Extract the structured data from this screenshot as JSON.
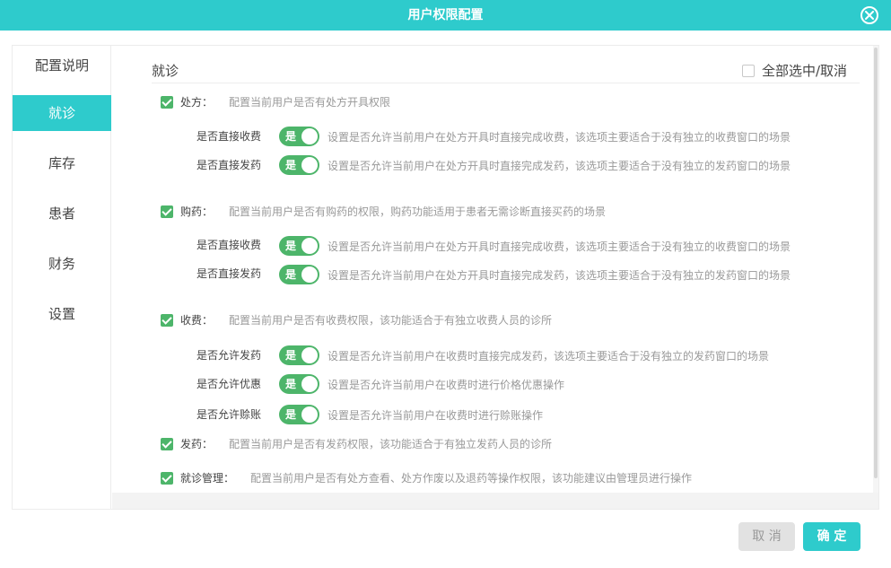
{
  "window": {
    "title": "用户权限配置"
  },
  "sidebar": {
    "title": "配置说明",
    "items": [
      {
        "label": "就诊",
        "active": true
      },
      {
        "label": "库存",
        "active": false
      },
      {
        "label": "患者",
        "active": false
      },
      {
        "label": "财务",
        "active": false
      },
      {
        "label": "设置",
        "active": false
      }
    ]
  },
  "content": {
    "section_title": "就诊",
    "select_all_label": "全部选中/取消",
    "permissions": [
      {
        "label": "处方：",
        "desc": "配置当前用户是否有处方开具权限",
        "checked": true,
        "options": [
          {
            "label": "是否直接收费",
            "toggle": "是",
            "desc": "设置是否允许当前用户在处方开具时直接完成收费，该选项主要适合于没有独立的收费窗口的场景"
          },
          {
            "label": "是否直接发药",
            "toggle": "是",
            "desc": "设置是否允许当前用户在处方开具时直接完成发药，该选项主要适合于没有独立的发药窗口的场景"
          }
        ]
      },
      {
        "label": "购药：",
        "desc": "配置当前用户是否有购药的权限，购药功能适用于患者无需诊断直接买药的场景",
        "checked": true,
        "options": [
          {
            "label": "是否直接收费",
            "toggle": "是",
            "desc": "设置是否允许当前用户在处方开具时直接完成收费，该选项主要适合于没有独立的收费窗口的场景"
          },
          {
            "label": "是否直接发药",
            "toggle": "是",
            "desc": "设置是否允许当前用户在处方开具时直接完成发药，该选项主要适合于没有独立的发药窗口的场景"
          }
        ]
      },
      {
        "label": "收费：",
        "desc": "配置当前用户是否有收费权限，该功能适合于有独立收费人员的诊所",
        "checked": true,
        "options": [
          {
            "label": "是否允许发药",
            "toggle": "是",
            "desc": "设置是否允许当前用户在收费时直接完成发药，该选项主要适合于没有独立的发药窗口的场景"
          },
          {
            "label": "是否允许优惠",
            "toggle": "是",
            "desc": "设置是否允许当前用户在收费时进行价格优惠操作"
          },
          {
            "label": "是否允许赊账",
            "toggle": "是",
            "desc": "设置是否允许当前用户在收费时进行赊账操作"
          }
        ]
      },
      {
        "label": "发药：",
        "desc": "配置当前用户是否有发药权限，该功能适合于有独立发药人员的诊所",
        "checked": true,
        "options": []
      },
      {
        "label": "就诊管理：",
        "desc": "配置当前用户是否有处方查看、处方作废以及退药等操作权限，该功能建议由管理员进行操作",
        "checked": true,
        "options": []
      }
    ]
  },
  "footer": {
    "cancel_label": "取 消",
    "ok_label": "确 定"
  },
  "colors": {
    "accent": "#2ecbcc",
    "toggle_on": "#4db56a",
    "muted_text": "#999999"
  },
  "icons": {
    "close": "close-circle-icon",
    "check": "check-icon"
  }
}
